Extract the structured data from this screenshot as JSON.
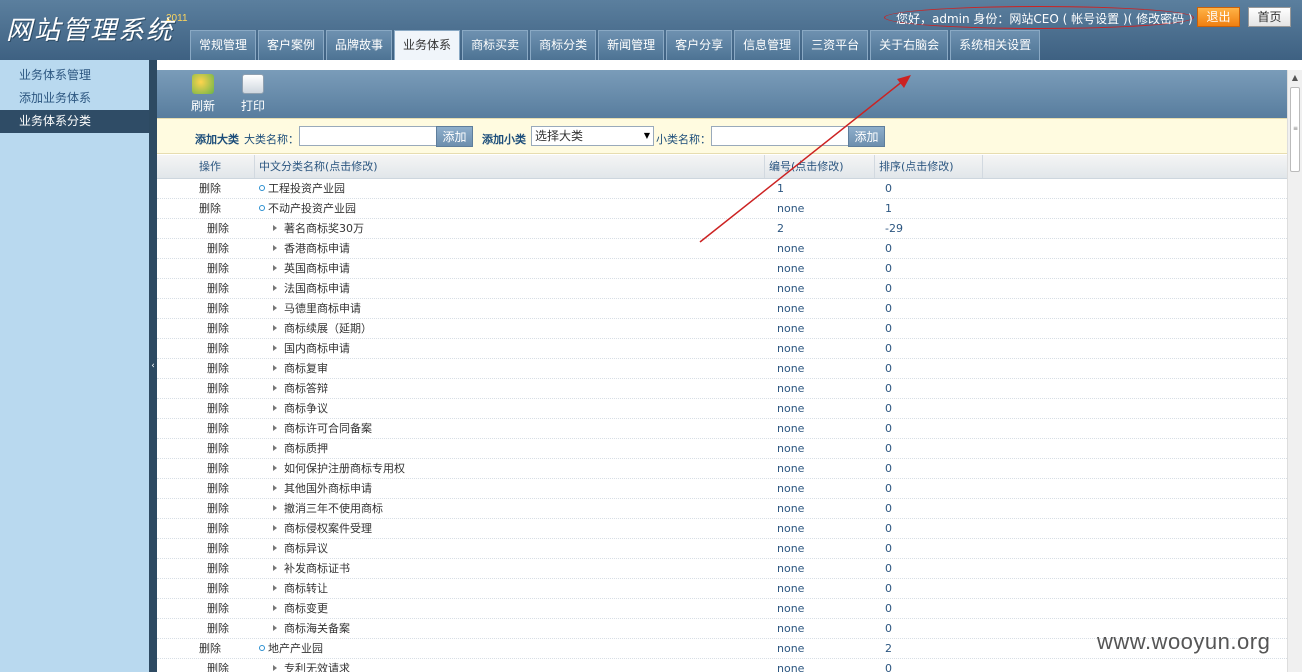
{
  "header": {
    "logo": "网站管理系统",
    "logo_year": "2011",
    "user_info": "您好，admin  身份：网站CEO ( 帐号设置 )( 修改密码 )",
    "logout_label": "退出",
    "home_label": "首页"
  },
  "nav": {
    "tabs": [
      {
        "label": "常规管理"
      },
      {
        "label": "客户案例"
      },
      {
        "label": "品牌故事"
      },
      {
        "label": "业务体系",
        "active": true
      },
      {
        "label": "商标买卖"
      },
      {
        "label": "商标分类"
      },
      {
        "label": "新闻管理"
      },
      {
        "label": "客户分享"
      },
      {
        "label": "信息管理"
      },
      {
        "label": "三资平台"
      },
      {
        "label": "关于右脑会"
      },
      {
        "label": "系统相关设置"
      }
    ]
  },
  "sidebar": {
    "items": [
      {
        "label": "业务体系管理"
      },
      {
        "label": "添加业务体系"
      },
      {
        "label": "业务体系分类",
        "active": true
      }
    ],
    "collapse_glyph": "‹"
  },
  "toolbar": {
    "refresh_label": "刷新",
    "print_label": "打印"
  },
  "addbar": {
    "add_major_label": "添加大类",
    "major_name_label": "大类名称：",
    "major_add_btn": "添加",
    "add_minor_label": "添加小类",
    "select_value": "选择大类",
    "minor_name_label": "小类名称：",
    "minor_add_btn": "添加"
  },
  "table": {
    "headers": [
      "操作",
      "中文分类名称(点击修改)",
      "编号(点击修改)",
      "排序(点击修改)"
    ],
    "rows": [
      {
        "level": 0,
        "op": "删除",
        "name": "工程投资产业园",
        "code": "1",
        "sort": "0"
      },
      {
        "level": 0,
        "op": "删除",
        "name": "不动产投资产业园",
        "code": "none",
        "sort": "1"
      },
      {
        "level": 1,
        "op": "删除",
        "name": "著名商标奖30万",
        "code": "2",
        "sort": "-29"
      },
      {
        "level": 1,
        "op": "删除",
        "name": "香港商标申请",
        "code": "none",
        "sort": "0"
      },
      {
        "level": 1,
        "op": "删除",
        "name": "英国商标申请",
        "code": "none",
        "sort": "0"
      },
      {
        "level": 1,
        "op": "删除",
        "name": "法国商标申请",
        "code": "none",
        "sort": "0"
      },
      {
        "level": 1,
        "op": "删除",
        "name": "马德里商标申请",
        "code": "none",
        "sort": "0"
      },
      {
        "level": 1,
        "op": "删除",
        "name": "商标续展（延期）",
        "code": "none",
        "sort": "0"
      },
      {
        "level": 1,
        "op": "删除",
        "name": "国内商标申请",
        "code": "none",
        "sort": "0"
      },
      {
        "level": 1,
        "op": "删除",
        "name": "商标复审",
        "code": "none",
        "sort": "0"
      },
      {
        "level": 1,
        "op": "删除",
        "name": "商标答辩",
        "code": "none",
        "sort": "0"
      },
      {
        "level": 1,
        "op": "删除",
        "name": "商标争议",
        "code": "none",
        "sort": "0"
      },
      {
        "level": 1,
        "op": "删除",
        "name": "商标许可合同备案",
        "code": "none",
        "sort": "0"
      },
      {
        "level": 1,
        "op": "删除",
        "name": "商标质押",
        "code": "none",
        "sort": "0"
      },
      {
        "level": 1,
        "op": "删除",
        "name": "如何保护注册商标专用权",
        "code": "none",
        "sort": "0"
      },
      {
        "level": 1,
        "op": "删除",
        "name": "其他国外商标申请",
        "code": "none",
        "sort": "0"
      },
      {
        "level": 1,
        "op": "删除",
        "name": "撤消三年不使用商标",
        "code": "none",
        "sort": "0"
      },
      {
        "level": 1,
        "op": "删除",
        "name": "商标侵权案件受理",
        "code": "none",
        "sort": "0"
      },
      {
        "level": 1,
        "op": "删除",
        "name": "商标异议",
        "code": "none",
        "sort": "0"
      },
      {
        "level": 1,
        "op": "删除",
        "name": "补发商标证书",
        "code": "none",
        "sort": "0"
      },
      {
        "level": 1,
        "op": "删除",
        "name": "商标转让",
        "code": "none",
        "sort": "0"
      },
      {
        "level": 1,
        "op": "删除",
        "name": "商标变更",
        "code": "none",
        "sort": "0"
      },
      {
        "level": 1,
        "op": "删除",
        "name": "商标海关备案",
        "code": "none",
        "sort": "0"
      },
      {
        "level": 0,
        "op": "删除",
        "name": "地产产业园",
        "code": "none",
        "sort": "2"
      },
      {
        "level": 1,
        "op": "删除",
        "name": "专利无效请求",
        "code": "none",
        "sort": "0"
      }
    ]
  },
  "watermark": "www.wooyun.org",
  "colors": {
    "header_bg": "#4a6e8f",
    "sidebar_bg": "#b9d9ef",
    "active_side": "#2f4c66",
    "annotation_red": "#cc2222",
    "logout_orange": "#f08a1c"
  }
}
